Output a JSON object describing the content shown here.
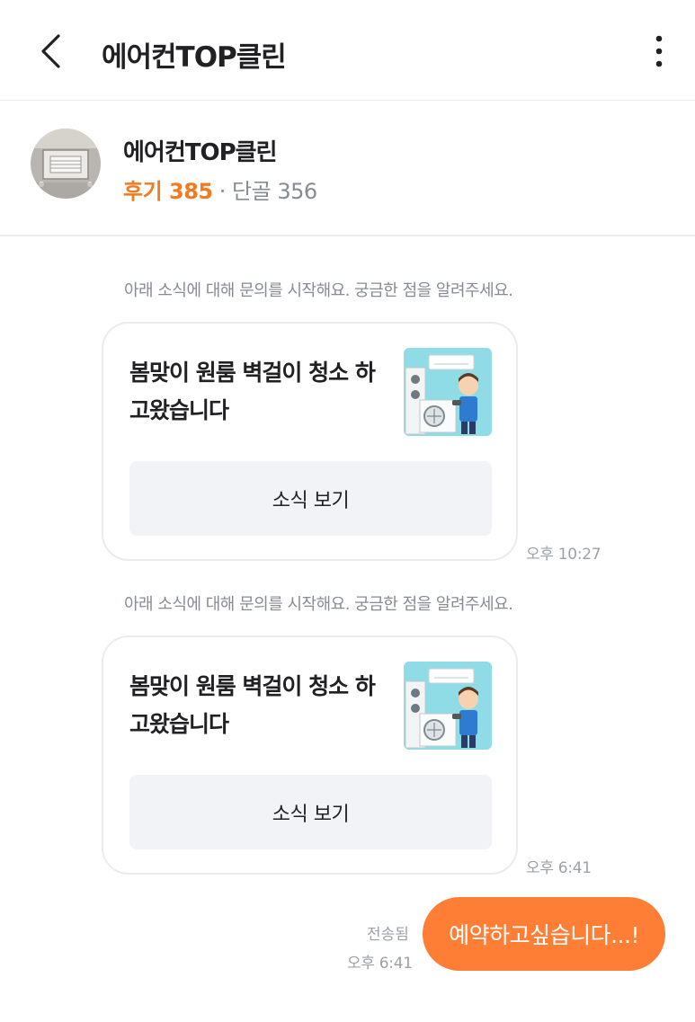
{
  "header": {
    "title": "에어컨TOP클린",
    "icons": {
      "back": "chevron-left-icon",
      "more": "more-vertical-icon"
    }
  },
  "profile": {
    "name": "에어컨TOP클린",
    "review_label": "후기 385",
    "separator": "·",
    "regular_label": "단골 356",
    "avatar": "air-conditioner-photo"
  },
  "messages": [
    {
      "system_text": "아래 소식에 대해 문의를 시작해요. 궁금한 점을 알려주세요.",
      "card_title": "봄맞이 원룸 벽걸이 청소 하고왔습니다",
      "card_button": "소식 보기",
      "time": "오후 10:27"
    },
    {
      "system_text": "아래 소식에 대해 문의를 시작해요. 궁금한 점을 알려주세요.",
      "card_title": "봄맞이 원룸 벽걸이 청소 하고왔습니다",
      "card_button": "소식 보기",
      "time": "오후 6:41"
    }
  ],
  "outgoing": {
    "text": "예약하고싶습니다...!",
    "status": "전송됨",
    "time": "오후 6:41"
  },
  "colors": {
    "accent": "#ff7e36",
    "review": "#f27a1f",
    "muted": "#868b94",
    "button_bg": "#f2f3f6"
  }
}
